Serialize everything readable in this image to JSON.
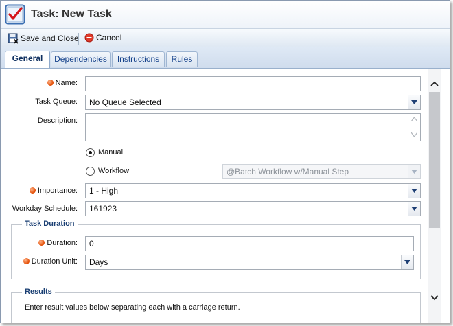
{
  "window": {
    "title": "Task: New Task",
    "app_icon": "checklist-icon"
  },
  "toolbar": {
    "save_close_label": "Save and Close",
    "save_icon": "save-close-icon",
    "cancel_label": "Cancel",
    "cancel_icon": "cancel-icon"
  },
  "tabs": [
    {
      "label": "General",
      "active": true
    },
    {
      "label": "Dependencies",
      "active": false
    },
    {
      "label": "Instructions",
      "active": false
    },
    {
      "label": "Rules",
      "active": false
    }
  ],
  "form": {
    "name_label": "Name:",
    "name_value": "",
    "task_queue_label": "Task Queue:",
    "task_queue_value": "No Queue Selected",
    "description_label": "Description:",
    "description_value": "",
    "manual_label": "Manual",
    "workflow_label": "Workflow",
    "workflow_value": "@Batch Workflow w/Manual Step",
    "importance_label": "Importance:",
    "importance_value": "1 - High",
    "workday_label": "Workday Schedule:",
    "workday_value": "161923"
  },
  "duration": {
    "legend": "Task Duration",
    "duration_label": "Duration:",
    "duration_value": "0",
    "unit_label": "Duration Unit:",
    "unit_value": "Days"
  },
  "results": {
    "legend": "Results",
    "hint": "Enter result values below separating each with a carriage return."
  },
  "colors": {
    "required": "#e24a00",
    "tab_text": "#15428b",
    "legend": "#1a3f73"
  }
}
